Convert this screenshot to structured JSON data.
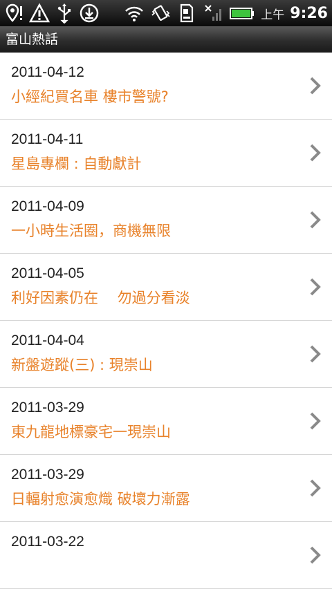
{
  "status_bar": {
    "icons": [
      "location-alert-icon",
      "warning-icon",
      "usb-icon",
      "download-icon",
      "wifi-icon",
      "vibrate-icon",
      "sd-card-icon",
      "no-signal-icon",
      "battery-icon"
    ],
    "ampm": "上午",
    "time": "9:26"
  },
  "app": {
    "title": "富山熱話"
  },
  "items": [
    {
      "date": "2011-04-12",
      "title": "小經紀買名車 樓市警號?"
    },
    {
      "date": "2011-04-11",
      "title": "星島專欄 : 自動獻計"
    },
    {
      "date": "2011-04-09",
      "title": "一小時生活圈，商機無限"
    },
    {
      "date": "2011-04-05",
      "title": "利好因素仍在　 勿過分看淡"
    },
    {
      "date": "2011-04-04",
      "title": "新盤遊蹤(三) : 現崇山"
    },
    {
      "date": "2011-03-29",
      "title": "東九龍地標豪宅一現崇山"
    },
    {
      "date": "2011-03-29",
      "title": "日輻射愈演愈熾 破壞力漸露"
    },
    {
      "date": "2011-03-22",
      "title": ""
    }
  ],
  "colors": {
    "title_text": "#e8822a",
    "date_text": "#222222",
    "divider": "#d6d6d6"
  }
}
